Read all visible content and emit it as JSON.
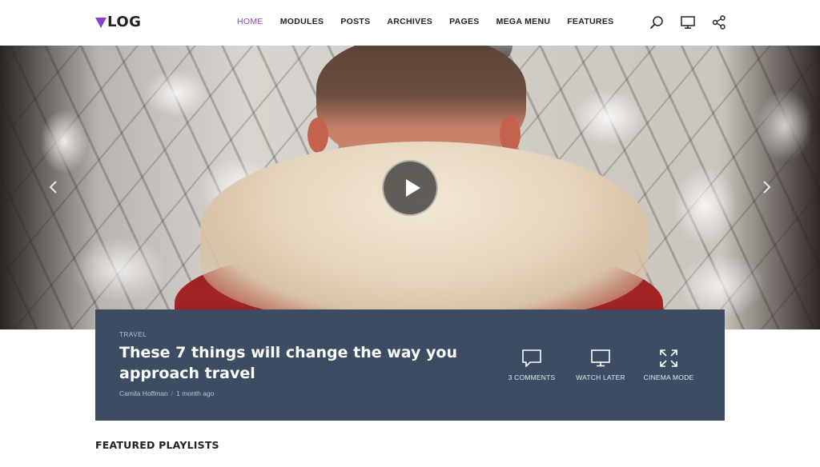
{
  "header": {
    "logo_text": "LOG",
    "accent_color": "#8a3fd1",
    "nav": [
      {
        "label": "HOME",
        "active": true
      },
      {
        "label": "MODULES",
        "active": false
      },
      {
        "label": "POSTS",
        "active": false
      },
      {
        "label": "ARCHIVES",
        "active": false
      },
      {
        "label": "PAGES",
        "active": false
      },
      {
        "label": "MEGA MENU",
        "active": false
      },
      {
        "label": "FEATURES",
        "active": false
      }
    ],
    "icons": [
      "search-icon",
      "monitor-icon",
      "share-icon"
    ]
  },
  "hero": {
    "play_icon": "play-icon",
    "prev_icon": "chevron-left-icon",
    "next_icon": "chevron-right-icon"
  },
  "post": {
    "category": "TRAVEL",
    "title": "These 7 things will change the way you approach travel",
    "author": "Camila Hoffman",
    "separator": "/",
    "date": "1 month ago",
    "panel_color": "#3b4c63",
    "actions": [
      {
        "icon": "comment-icon",
        "label": "3 COMMENTS"
      },
      {
        "icon": "monitor-icon",
        "label": "WATCH LATER"
      },
      {
        "icon": "expand-icon",
        "label": "CINEMA MODE"
      }
    ]
  },
  "section": {
    "title": "FEATURED PLAYLISTS"
  }
}
